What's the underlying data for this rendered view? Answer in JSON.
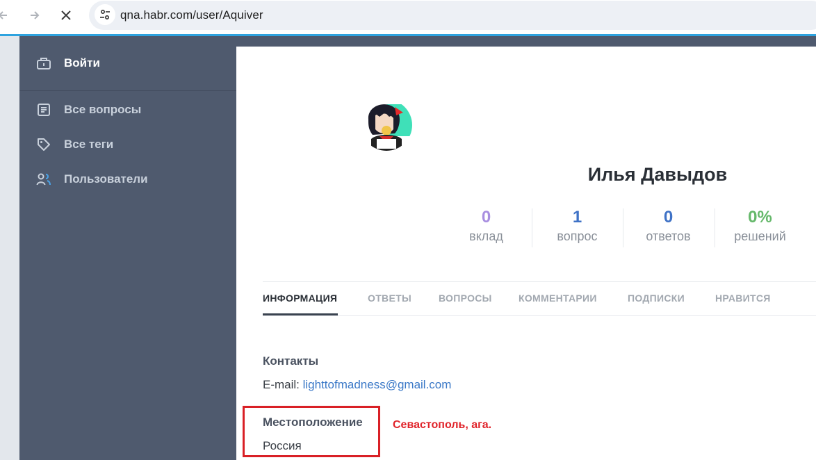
{
  "browser": {
    "url": "qna.habr.com/user/Aquiver",
    "back_icon": "arrow-left-icon",
    "forward_icon": "arrow-right-icon",
    "stop_icon": "close-icon",
    "site_info_icon": "tune-icon",
    "load_bar_color": "#2ea3df"
  },
  "sidebar": {
    "login_label": "Войти",
    "items": [
      {
        "label": "Все вопросы",
        "icon": "document-icon"
      },
      {
        "label": "Все теги",
        "icon": "tag-icon"
      },
      {
        "label": "Пользователи",
        "icon": "users-icon"
      }
    ]
  },
  "profile": {
    "name": "Илья Давыдов",
    "stats": [
      {
        "value": "0",
        "label": "вклад",
        "color": "#a88ee0"
      },
      {
        "value": "1",
        "label": "вопрос",
        "color": "#3f72c6"
      },
      {
        "value": "0",
        "label": "ответов",
        "color": "#3f72c6"
      },
      {
        "value": "0%",
        "label": "решений",
        "color": "#65b86a"
      }
    ]
  },
  "tabs": [
    {
      "label": "ИНФОРМАЦИЯ",
      "active": true
    },
    {
      "label": "ОТВЕТЫ"
    },
    {
      "label": "ВОПРОСЫ"
    },
    {
      "label": "КОММЕНТАРИИ"
    },
    {
      "label": "ПОДПИСКИ"
    },
    {
      "label": "НРАВИТСЯ"
    }
  ],
  "info": {
    "contacts_title": "Контакты",
    "email_label": "E-mail: ",
    "email_value": "lighttofmadness@gmail.com",
    "location_title": "Местоположение",
    "location_value": "Россия"
  },
  "annotation": {
    "note": "Севастополь, ага.",
    "box_color": "#d92026"
  }
}
